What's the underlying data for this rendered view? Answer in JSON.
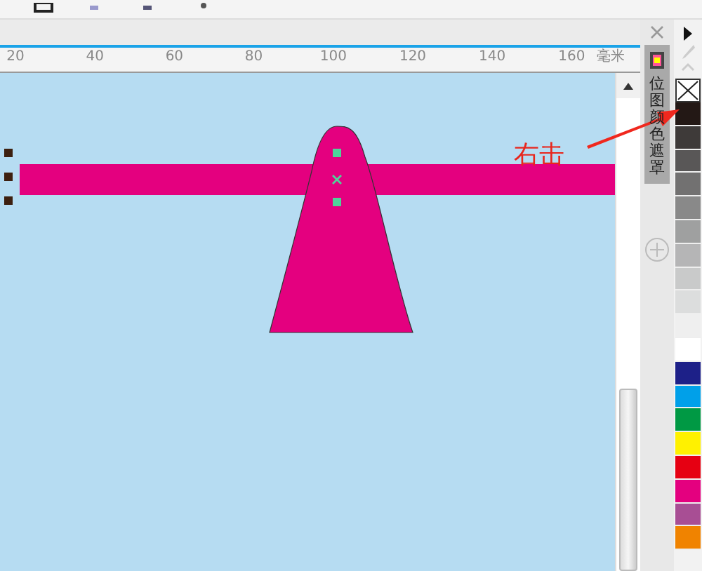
{
  "ruler": {
    "ticks": [
      "20",
      "40",
      "60",
      "80",
      "100",
      "120",
      "140",
      "160"
    ],
    "unit": "毫米"
  },
  "docker": {
    "tab_label": "位图颜色遮罩"
  },
  "palette": {
    "swatches": [
      {
        "kind": "none"
      },
      {
        "kind": "color",
        "color": "#231815"
      },
      {
        "kind": "color",
        "color": "#3e3a39"
      },
      {
        "kind": "color",
        "color": "#595757"
      },
      {
        "kind": "color",
        "color": "#727171"
      },
      {
        "kind": "color",
        "color": "#898989"
      },
      {
        "kind": "color",
        "color": "#9fa0a0"
      },
      {
        "kind": "color",
        "color": "#b5b5b6"
      },
      {
        "kind": "color",
        "color": "#c9caca"
      },
      {
        "kind": "color",
        "color": "#dcdddd"
      },
      {
        "kind": "color",
        "color": "#efefef"
      },
      {
        "kind": "color",
        "color": "#ffffff"
      },
      {
        "kind": "color",
        "color": "#1d2088"
      },
      {
        "kind": "color",
        "color": "#00a0e9"
      },
      {
        "kind": "color",
        "color": "#009944"
      },
      {
        "kind": "color",
        "color": "#fff100"
      },
      {
        "kind": "color",
        "color": "#e60012"
      },
      {
        "kind": "color",
        "color": "#e4007f"
      },
      {
        "kind": "color",
        "color": "#a84e94"
      },
      {
        "kind": "color",
        "color": "#f08300"
      }
    ]
  },
  "annotation": {
    "text": "右击"
  }
}
